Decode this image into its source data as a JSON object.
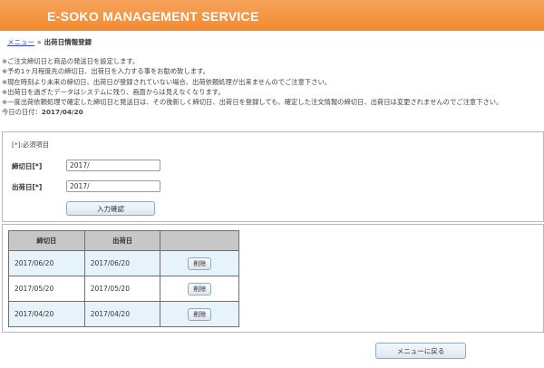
{
  "header": {
    "title": "E-SOKO MANAGEMENT SERVICE"
  },
  "breadcrumb": {
    "menu_link": "メニュー",
    "separator": "»",
    "current": "出荷日情報登録"
  },
  "notes": [
    "※ご注文締切日と商品の発送日を設定します。",
    "※予め1ヶ月程度先の締切日、出荷日を入力する事をお勧め致します。",
    "※現在時刻より未来の締切日、出荷日が登録されていない場合、出荷依頼処理が出来ませんのでご注意下さい。",
    "※出荷日を過ぎたデータはシステムに残り、画面からは見えなくなります。",
    "※一度出荷依頼処理で確定した締切日と発送日は、その後新しく締切日、出荷日を登録しても、確定した注文情報の締切日、出荷日は変更されませんのでご注意下さい。"
  ],
  "today": {
    "label": "今日の日付：",
    "value": "2017/04/20"
  },
  "form": {
    "required_note": "[*]:必須項目",
    "deadline_label": "締切日[*]",
    "deadline_value": "2017/",
    "ship_label": "出荷日[*]",
    "ship_value": "2017/",
    "confirm_label": "入力確認"
  },
  "table": {
    "headers": [
      "締切日",
      "出荷日",
      ""
    ],
    "rows": [
      {
        "deadline": "2017/06/20",
        "ship": "2017/06/20",
        "action": "削除"
      },
      {
        "deadline": "2017/05/20",
        "ship": "2017/05/20",
        "action": "削除"
      },
      {
        "deadline": "2017/04/20",
        "ship": "2017/04/20",
        "action": "削除"
      }
    ]
  },
  "footer": {
    "back_label": "メニューに戻る"
  },
  "colors": {
    "header_orange": "#f28a2e",
    "row_blue": "#e7f3fa",
    "header_gray": "#c7c7c7",
    "link": "#3344aa"
  }
}
